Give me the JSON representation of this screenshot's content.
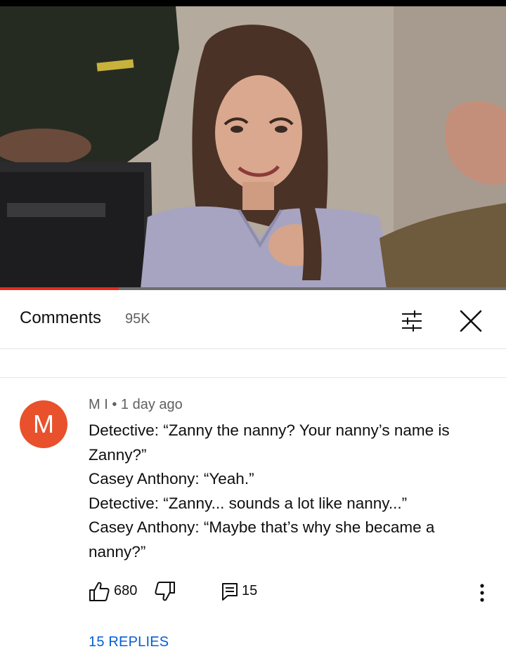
{
  "video": {
    "progress_fraction": 0.235,
    "accent_color": "#e8291c"
  },
  "comments_header": {
    "title": "Comments",
    "count": "95K",
    "sort_icon": "sort-filter-icon",
    "close_icon": "close-icon"
  },
  "comment": {
    "avatar_letter": "M",
    "avatar_color": "#e8512b",
    "author": "M I",
    "separator": "•",
    "time": "1 day ago",
    "lines": [
      "Detective: “Zanny the nanny? Your nanny’s name is",
      "Zanny?”",
      "Casey Anthony: “Yeah.”",
      "Detective: “Zanny... sounds a lot like nanny...”",
      "Casey Anthony: “Maybe that’s why she became a",
      "nanny?”"
    ],
    "like_count": "680",
    "reply_count": "15",
    "replies_link": "15 REPLIES",
    "link_color": "#065fd4"
  }
}
